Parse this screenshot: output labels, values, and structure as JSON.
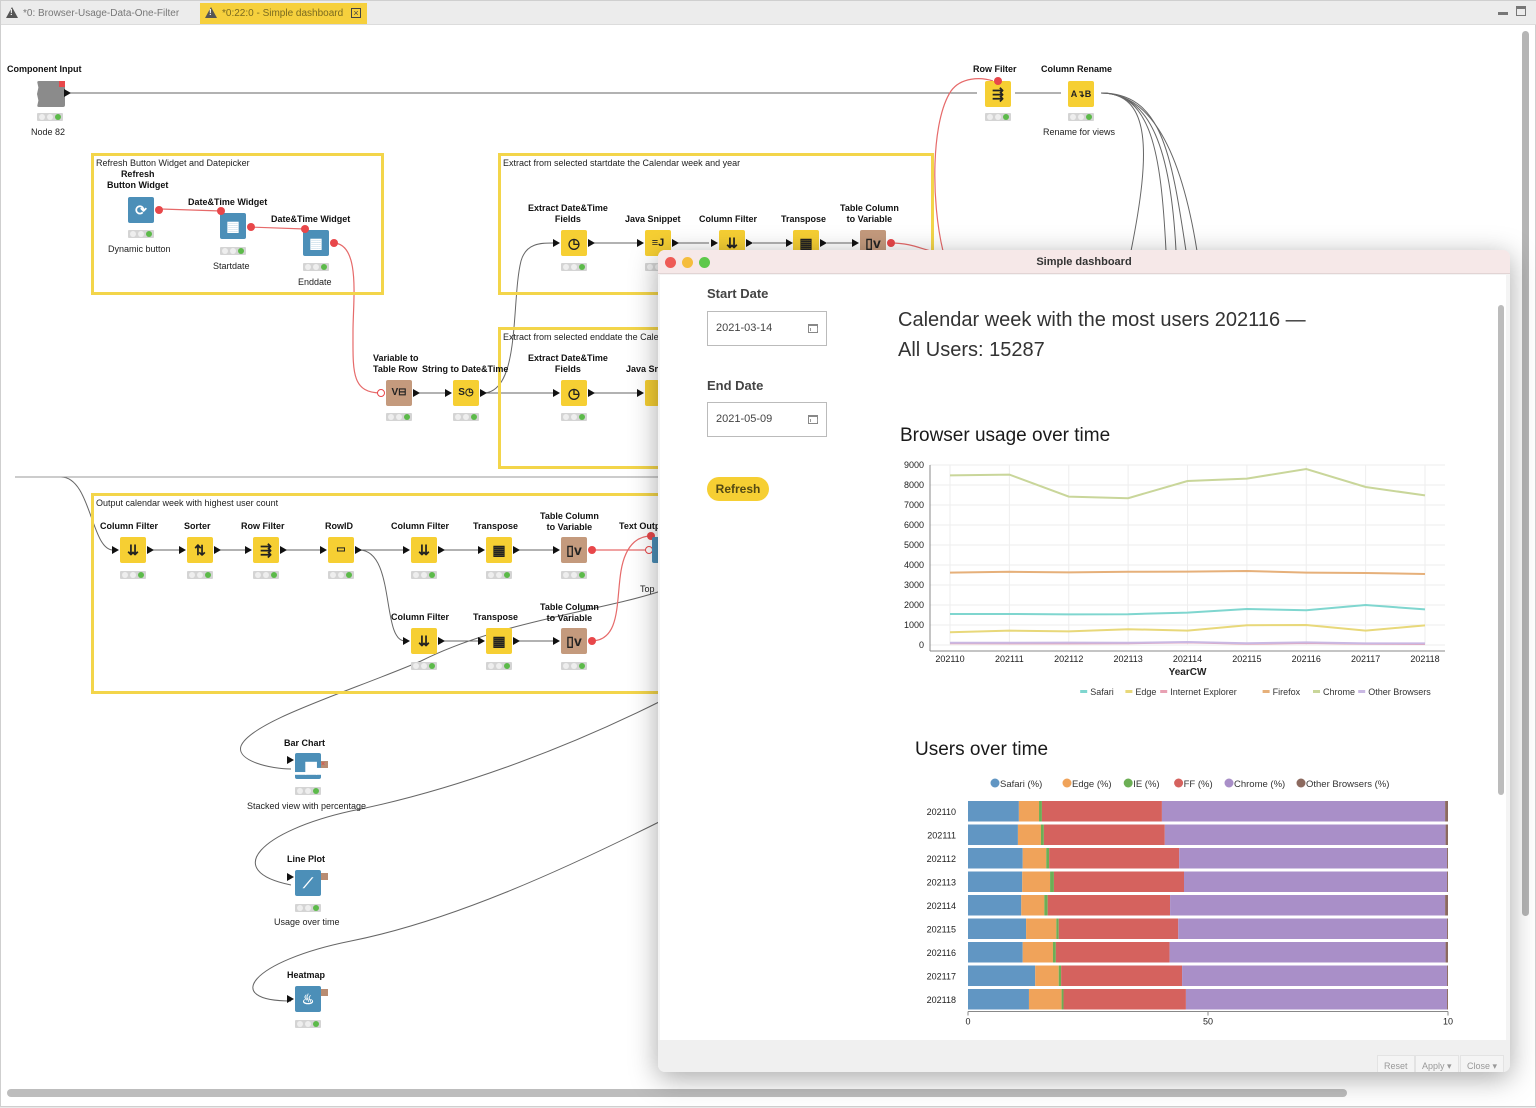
{
  "tabs": [
    {
      "label": "*0: Browser-Usage-Data-One-Filter",
      "active": false
    },
    {
      "label": "*0:22:0 - Simple dashboard",
      "active": true
    }
  ],
  "window_controls": {
    "minimize": "minimize-icon",
    "maximize": "maximize-icon"
  },
  "workflow": {
    "annotations": [
      {
        "title": "Refresh Button Widget and Datepicker"
      },
      {
        "title": "Extract from selected startdate the Calendar week and year"
      },
      {
        "title": "Extract from selected enddate the Cale"
      },
      {
        "title": "Output calendar week with highest user count"
      }
    ],
    "nodes": [
      {
        "id": "component-input",
        "label": "Component Input",
        "caption": "Node 82",
        "type": "gray",
        "icon": "component-input-icon"
      },
      {
        "id": "row-filter-top",
        "label": "Row Filter",
        "caption": "",
        "type": "yellow",
        "icon": "row-filter-icon"
      },
      {
        "id": "column-rename",
        "label": "Column Rename",
        "caption": "Rename for views",
        "type": "yellow",
        "icon": "column-rename-icon"
      },
      {
        "id": "refresh-button-widget",
        "label": "Refresh\nButton Widget",
        "caption": "Dynamic button",
        "type": "blue",
        "icon": "refresh-icon"
      },
      {
        "id": "datetime-widget-start",
        "label": "Date&Time Widget",
        "caption": "Startdate",
        "type": "blue",
        "icon": "calendar-icon"
      },
      {
        "id": "datetime-widget-end",
        "label": "Date&Time Widget",
        "caption": "Enddate",
        "type": "blue",
        "icon": "calendar-icon"
      },
      {
        "id": "extract-dt-1",
        "label": "Extract Date&Time\nFields",
        "caption": "",
        "type": "yellow",
        "icon": "clock-icon"
      },
      {
        "id": "java-snippet-1",
        "label": "Java Snippet",
        "caption": "",
        "type": "yellow",
        "icon": "java-icon"
      },
      {
        "id": "column-filter-1",
        "label": "Column Filter",
        "caption": "",
        "type": "yellow",
        "icon": "column-filter-icon"
      },
      {
        "id": "transpose-1",
        "label": "Transpose",
        "caption": "",
        "type": "yellow",
        "icon": "transpose-icon"
      },
      {
        "id": "tcv-1",
        "label": "Table Column\nto Variable",
        "caption": "",
        "type": "brown",
        "icon": "table-to-variable-icon"
      },
      {
        "id": "var-to-table-row",
        "label": "Variable to\nTable Row",
        "caption": "",
        "type": "brown",
        "icon": "variable-to-table-icon"
      },
      {
        "id": "string-to-datetime",
        "label": "String to Date&Time",
        "caption": "",
        "type": "yellow",
        "icon": "string-to-date-icon"
      },
      {
        "id": "extract-dt-2",
        "label": "Extract Date&Time\nFields",
        "caption": "",
        "type": "yellow",
        "icon": "clock-icon"
      },
      {
        "id": "java-snippet-2",
        "label": "Java Sn",
        "caption": "",
        "type": "yellow",
        "icon": "java-icon"
      },
      {
        "id": "column-filter-2",
        "label": "Column Filter",
        "caption": "",
        "type": "yellow",
        "icon": "column-filter-icon"
      },
      {
        "id": "sorter",
        "label": "Sorter",
        "caption": "",
        "type": "yellow",
        "icon": "sorter-icon"
      },
      {
        "id": "row-filter-2",
        "label": "Row Filter",
        "caption": "",
        "type": "yellow",
        "icon": "row-filter-icon"
      },
      {
        "id": "rowid",
        "label": "RowID",
        "caption": "",
        "type": "yellow",
        "icon": "rowid-icon"
      },
      {
        "id": "column-filter-3",
        "label": "Column Filter",
        "caption": "",
        "type": "yellow",
        "icon": "column-filter-icon"
      },
      {
        "id": "transpose-2",
        "label": "Transpose",
        "caption": "",
        "type": "yellow",
        "icon": "transpose-icon"
      },
      {
        "id": "tcv-2",
        "label": "Table Column\nto Variable",
        "caption": "",
        "type": "brown",
        "icon": "table-to-variable-icon"
      },
      {
        "id": "text-output",
        "label": "Text Outp",
        "caption": "Top",
        "type": "blue",
        "icon": "text-output-icon"
      },
      {
        "id": "column-filter-4",
        "label": "Column Filter",
        "caption": "",
        "type": "yellow",
        "icon": "column-filter-icon"
      },
      {
        "id": "transpose-3",
        "label": "Transpose",
        "caption": "",
        "type": "yellow",
        "icon": "transpose-icon"
      },
      {
        "id": "tcv-3",
        "label": "Table Column\nto Variable",
        "caption": "",
        "type": "brown",
        "icon": "table-to-variable-icon"
      },
      {
        "id": "bar-chart",
        "label": "Bar Chart",
        "caption": "Stacked view with percentage",
        "type": "blue",
        "icon": "bar-chart-icon"
      },
      {
        "id": "line-plot",
        "label": "Line Plot",
        "caption": "Usage over time",
        "type": "blue",
        "icon": "line-plot-icon"
      },
      {
        "id": "heatmap",
        "label": "Heatmap",
        "caption": "",
        "type": "blue",
        "icon": "heatmap-icon"
      }
    ]
  },
  "dashboard": {
    "window_title": "Simple dashboard",
    "start_date": {
      "label": "Start Date",
      "value": "2021-03-14"
    },
    "end_date": {
      "label": "End Date",
      "value": "2021-05-09"
    },
    "refresh_label": "Refresh",
    "headline_line1": "Calendar week with the most users 202116 —",
    "headline_line2": "All Users: 15287",
    "buttons": {
      "reset": "Reset",
      "apply": "Apply ▾",
      "close": "Close ▾"
    }
  },
  "chart_data": [
    {
      "type": "line",
      "title": "Browser usage over time",
      "xlabel": "YearCW",
      "ylabel": "",
      "x": [
        "202110",
        "202111",
        "202112",
        "202113",
        "202114",
        "202115",
        "202116",
        "202117",
        "202118"
      ],
      "ylim": [
        0,
        9000
      ],
      "yticks": [
        0,
        1000,
        2000,
        3000,
        4000,
        5000,
        6000,
        7000,
        8000,
        9000
      ],
      "grid": true,
      "legend": "bottom-right",
      "series": [
        {
          "name": "Safari",
          "color": "#7fd6cf",
          "values": [
            1550,
            1550,
            1530,
            1540,
            1620,
            1800,
            1740,
            2000,
            1780
          ]
        },
        {
          "name": "Edge",
          "color": "#e8d87a",
          "values": [
            640,
            720,
            680,
            790,
            720,
            990,
            1000,
            720,
            980
          ]
        },
        {
          "name": "Internet Explorer",
          "color": "#e8a1b3",
          "values": [
            90,
            80,
            80,
            90,
            130,
            60,
            100,
            60,
            50
          ]
        },
        {
          "name": "Firefox",
          "color": "#e6b07a",
          "values": [
            3620,
            3660,
            3630,
            3660,
            3670,
            3700,
            3620,
            3600,
            3550
          ]
        },
        {
          "name": "Chrome",
          "color": "#c9d69a",
          "values": [
            8480,
            8520,
            7420,
            7340,
            8200,
            8320,
            8800,
            7900,
            7480
          ]
        },
        {
          "name": "Other Browsers",
          "color": "#c9b8e3",
          "values": [
            110,
            110,
            120,
            110,
            150,
            90,
            130,
            80,
            80
          ]
        }
      ]
    },
    {
      "type": "bar",
      "orientation": "horizontal",
      "stacked": true,
      "title": "Users over time",
      "categories": [
        "202110",
        "202111",
        "202112",
        "202113",
        "202114",
        "202115",
        "202116",
        "202117",
        "202118"
      ],
      "xlim": [
        0,
        100
      ],
      "xticks": [
        "0",
        "50",
        "10"
      ],
      "legend": "top",
      "series": [
        {
          "name": "Safari (%)",
          "color": "#6196c3",
          "values": [
            10.6,
            10.4,
            11.4,
            11.3,
            11.1,
            12.1,
            11.4,
            14.0,
            12.7
          ]
        },
        {
          "name": "Edge (%)",
          "color": "#f0a35a",
          "values": [
            4.2,
            4.8,
            4.9,
            5.8,
            4.8,
            6.3,
            6.3,
            4.9,
            6.8
          ]
        },
        {
          "name": "IE (%)",
          "color": "#6caf55",
          "values": [
            0.6,
            0.6,
            0.6,
            0.8,
            0.7,
            0.5,
            0.6,
            0.5,
            0.4
          ]
        },
        {
          "name": "FF (%)",
          "color": "#d5625e",
          "values": [
            25.0,
            25.2,
            27.1,
            27.1,
            25.5,
            24.9,
            23.7,
            25.2,
            25.5
          ]
        },
        {
          "name": "Chrome (%)",
          "color": "#a98fc8",
          "values": [
            59.0,
            58.5,
            55.8,
            54.8,
            57.3,
            56.0,
            57.5,
            55.2,
            54.4
          ]
        },
        {
          "name": "Other Browsers (%)",
          "color": "#8c6a5f",
          "values": [
            0.6,
            0.5,
            0.2,
            0.2,
            0.6,
            0.2,
            0.5,
            0.2,
            0.2
          ]
        }
      ]
    }
  ]
}
